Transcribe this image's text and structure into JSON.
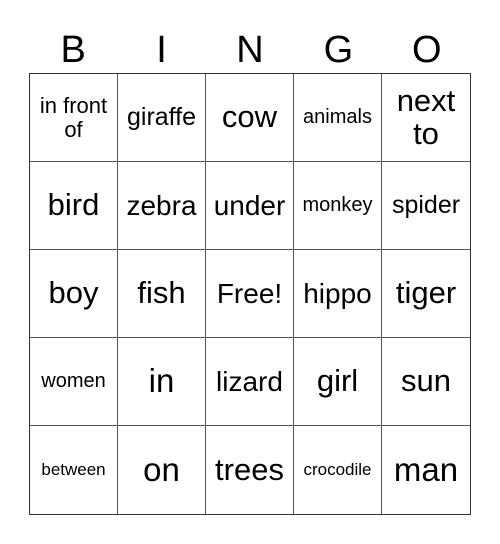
{
  "header": {
    "letters": [
      "B",
      "I",
      "N",
      "G",
      "O"
    ]
  },
  "board": {
    "rows": [
      [
        "in front of",
        "giraffe",
        "cow",
        "animals",
        "next to"
      ],
      [
        "bird",
        "zebra",
        "under",
        "monkey",
        "spider"
      ],
      [
        "boy",
        "fish",
        "Free!",
        "hippo",
        "tiger"
      ],
      [
        "women",
        "in",
        "lizard",
        "girl",
        "sun"
      ],
      [
        "between",
        "on",
        "trees",
        "crocodile",
        "man"
      ]
    ]
  }
}
